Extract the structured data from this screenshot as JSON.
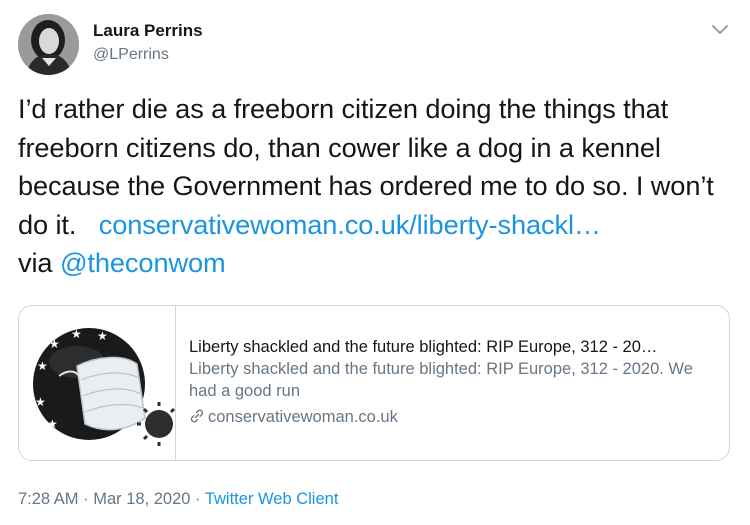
{
  "author": {
    "name": "Laura Perrins",
    "handle": "@LPerrins"
  },
  "tweet": {
    "text_before_link": "I’d rather die as a freeborn citizen doing the things that freeborn citizens do, than cower like a dog in a kennel because the Government has ordered me to do so. I won’t do it.",
    "link_text": "conservativewoman.co.uk/liberty-shackl…",
    "via_text": "via",
    "mention": "@theconwom"
  },
  "card": {
    "title": "Liberty shackled and the future blighted: RIP Europe, 312 - 20…",
    "description": "Liberty shackled and the future blighted: RIP Europe, 312 - 2020. We had a good run",
    "domain": "conservativewoman.co.uk",
    "image_icon": "eu-ball-with-face-mask-and-virus-image"
  },
  "meta": {
    "time": "7:28 AM",
    "separator1": " · ",
    "date": "Mar 18, 2020",
    "separator2": " · ",
    "client": "Twitter Web Client"
  },
  "colors": {
    "link": "#1b95e0",
    "secondary_text": "#657786",
    "border": "#ccd6dd"
  }
}
